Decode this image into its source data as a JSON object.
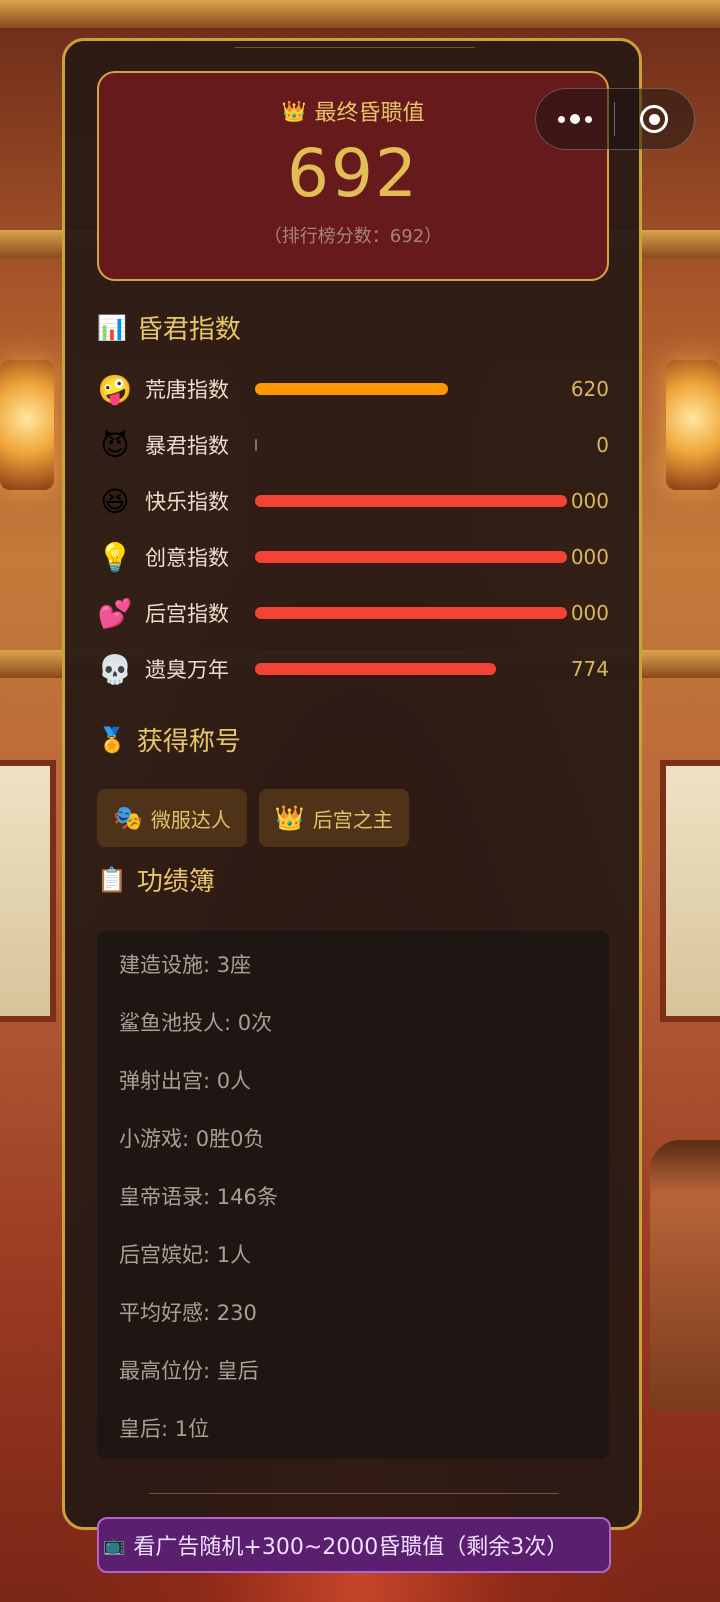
{
  "score": {
    "title": "最终昏聩值",
    "value": "692",
    "subtitle": "（排行榜分数：692）"
  },
  "index_section": {
    "title": "昏君指数",
    "stats": [
      {
        "emoji": "🤪",
        "label": "荒唐指数",
        "value": "620",
        "fill": 0.62,
        "color": "#ff9800"
      },
      {
        "emoji": "😈",
        "label": "暴君指数",
        "value": "0",
        "fill": 0.0,
        "color": "#f44336"
      },
      {
        "emoji": "😆",
        "label": "快乐指数",
        "value": "000",
        "fill": 1.0,
        "color": "#f44336"
      },
      {
        "emoji": "💡",
        "label": "创意指数",
        "value": "000",
        "fill": 1.0,
        "color": "#f44336"
      },
      {
        "emoji": "💕",
        "label": "后宫指数",
        "value": "000",
        "fill": 1.0,
        "color": "#f44336"
      },
      {
        "emoji": "💀",
        "label": "遗臭万年",
        "value": "774",
        "fill": 0.774,
        "color": "#f44336"
      }
    ]
  },
  "titles_section": {
    "title": "获得称号",
    "badges": [
      {
        "icon": "🎭",
        "label": "微服达人"
      },
      {
        "icon": "👑",
        "label": "后宫之主"
      }
    ]
  },
  "record_section": {
    "title": "功绩簿",
    "items": [
      "建造设施: 3座",
      "鲨鱼池投人: 0次",
      "弹射出宫: 0人",
      "小游戏: 0胜0负",
      "皇帝语录: 146条",
      "后宫嫔妃: 1人",
      "平均好感: 230",
      "最高位份: 皇后",
      "皇后: 1位"
    ]
  },
  "ad_button": {
    "label": "看广告随机+300~2000昏聩值（剩余3次）"
  },
  "icons": {
    "crown": "👑",
    "chart": "📊",
    "medal": "🏅",
    "clipboard": "📋",
    "tv": "📺"
  }
}
